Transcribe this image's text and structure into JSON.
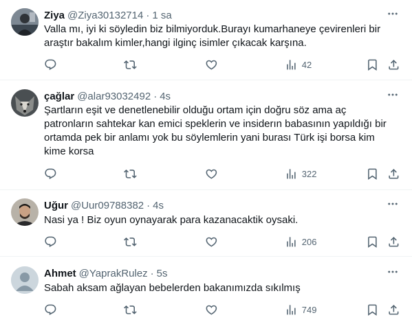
{
  "colors": {
    "text": "#0f1419",
    "secondary": "#536471",
    "divider": "#eff3f4"
  },
  "tweets": [
    {
      "name": "Ziya",
      "handle": "@Ziya30132714",
      "separator": "·",
      "time": "1 sa",
      "text": "Valla mı, iyi ki söyledin biz bilmiyorduk.Burayı kumarhaneye çevirenleri bir\naraştır bakalım kimler,hangi ilginç isimler çıkacak karşına.",
      "views": "42",
      "avatar": "ziya-avatar-photo"
    },
    {
      "name": "çağlar",
      "handle": "@alar93032492",
      "separator": "·",
      "time": "4s",
      "text": "Şartların eşit ve denetlenebilir olduğu ortam için doğru söz ama aç\npatronların sahtekar kan emici speklerin ve insiderın babasının yapıldığı bir\nortamda pek bir anlamı yok bu söylemlerin yani burası Türk işi borsa kim\nkime korsa",
      "views": "322",
      "avatar": "wolf-avatar-photo"
    },
    {
      "name": "Uğur",
      "handle": "@Uur09788382",
      "separator": "·",
      "time": "4s",
      "text": "Nasi ya ! Biz oyun oynayarak para kazanacaktik oysaki.",
      "views": "206",
      "avatar": "ugur-avatar-photo"
    },
    {
      "name": "Ahmet",
      "handle": "@YaprakRulez",
      "separator": "·",
      "time": "5s",
      "text": "Sabah aksam ağlayan bebelerden bakanımızda sıkılmış",
      "views": "749",
      "avatar": "default-avatar"
    }
  ]
}
